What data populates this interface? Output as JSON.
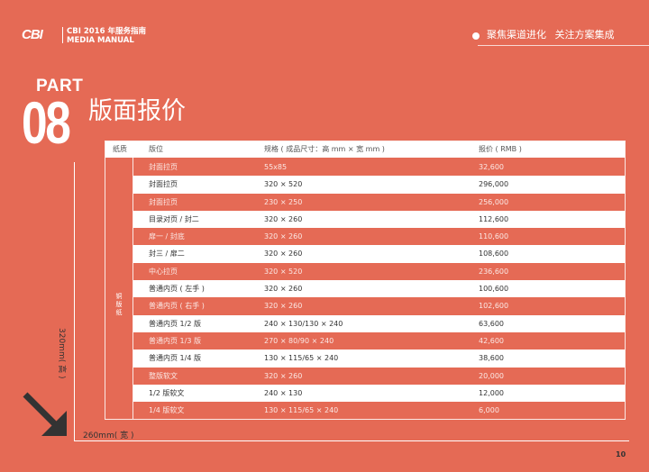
{
  "header": {
    "logo": "CBI",
    "brand_line1": "CBI 2016 年服务指南",
    "brand_line2": "MEDIA MANUAL",
    "tagline": "聚焦渠道进化 关注方案集成"
  },
  "section": {
    "part_label": "PART",
    "part_number": "08",
    "title": "版面报价"
  },
  "table": {
    "headers": {
      "paper": "纸质",
      "layout": "版位",
      "size": "规格 ( 成品尺寸：高 mm × 宽 mm )",
      "price": "报价 ( RMB )"
    },
    "paper_type": "铜版纸",
    "rows": [
      {
        "layout": "封面拉页",
        "size": "55x85",
        "price": "32,600"
      },
      {
        "layout": "封面拉页",
        "size": "320 × 520",
        "price": "296,000"
      },
      {
        "layout": "封面拉页",
        "size": "230 × 250",
        "price": "256,000"
      },
      {
        "layout": "目录对页 / 封二",
        "size": "320 × 260",
        "price": "112,600"
      },
      {
        "layout": "扉一 / 封底",
        "size": "320 × 260",
        "price": "110,600"
      },
      {
        "layout": "封三 / 扉二",
        "size": "320 × 260",
        "price": "108,600"
      },
      {
        "layout": "中心拉页",
        "size": "320 × 520",
        "price": "236,600"
      },
      {
        "layout": "普通内页 ( 左手 )",
        "size": "320 × 260",
        "price": "100,600"
      },
      {
        "layout": "普通内页 ( 右手 )",
        "size": "320 × 260",
        "price": "102,600"
      },
      {
        "layout": "普通内页 1/2 版",
        "size": "240 × 130/130 × 240",
        "price": "63,600"
      },
      {
        "layout": "普通内页 1/3 版",
        "size": "270 × 80/90 × 240",
        "price": "42,600"
      },
      {
        "layout": "普通内页 1/4 版",
        "size": "130 × 115/65 × 240",
        "price": "38,600"
      },
      {
        "layout": "整版软文",
        "size": "320 × 260",
        "price": "20,000"
      },
      {
        "layout": "1/2 版软文",
        "size": "240 × 130",
        "price": "12,000"
      },
      {
        "layout": "1/4 版软文",
        "size": "130 × 115/65 × 240",
        "price": "6,000"
      }
    ]
  },
  "dimensions": {
    "height_label": "320mm( 高 )",
    "width_label": "260mm( 宽 )"
  },
  "page_number": "10",
  "colors": {
    "background": "#E56A55",
    "row_white": "#FFFFFF",
    "text_dark": "#333333"
  }
}
